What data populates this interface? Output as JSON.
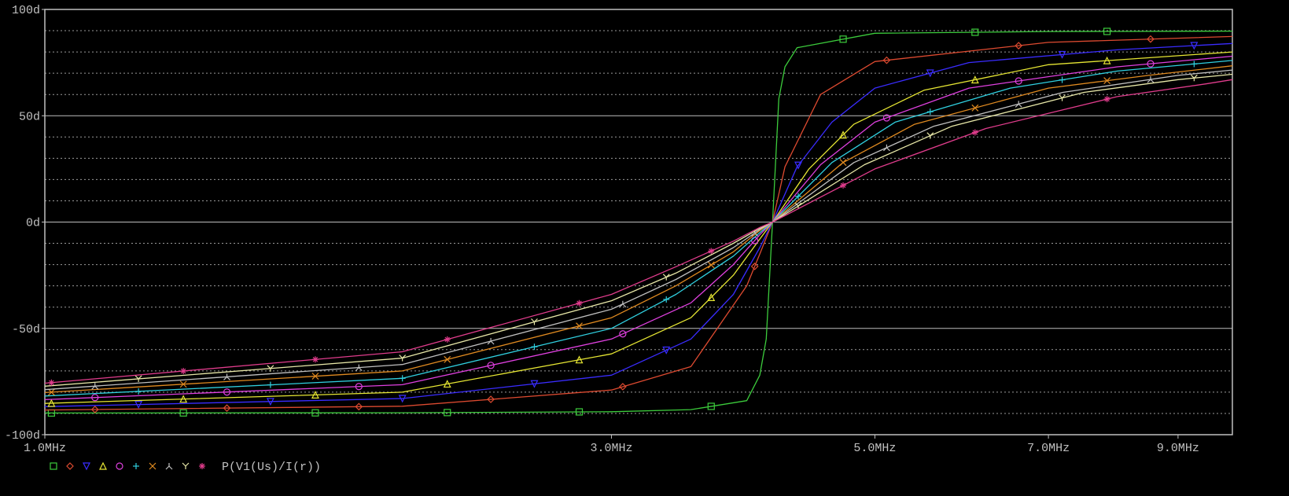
{
  "chart_data": {
    "type": "line",
    "x_scale": "log",
    "x_range_hz": [
      1000000,
      10000000
    ],
    "ylim": [
      -100,
      100
    ],
    "x_ticks": [
      {
        "value": 1000000,
        "label": "1.0MHz"
      },
      {
        "value": 3000000,
        "label": "3.0MHz"
      },
      {
        "value": 5000000,
        "label": "5.0MHz"
      },
      {
        "value": 7000000,
        "label": "7.0MHz"
      },
      {
        "value": 9000000,
        "label": "9.0MHz"
      }
    ],
    "y_ticks": [
      {
        "value": 100,
        "label": "100d"
      },
      {
        "value": 50,
        "label": "50d"
      },
      {
        "value": 0,
        "label": "0d"
      },
      {
        "value": -50,
        "label": "-50d"
      },
      {
        "value": -100,
        "label": "-100d"
      }
    ],
    "grid": "solid at labeled y ticks, dotted at 10d steps",
    "background": "#000000",
    "axis_color": "#c0c0c0",
    "center_frequency_hz": 4100000,
    "legend": {
      "position": "bottom-left",
      "label": "P(V1(Us)/I(r))"
    },
    "series": [
      {
        "color": "#3ccc3c",
        "marker": "square",
        "x": [
          1000000,
          2000000,
          3000000,
          3500000,
          3900000,
          4000000,
          4050000,
          4100000,
          4150000,
          4200000,
          4300000,
          5000000,
          7000000,
          10000000
        ],
        "y": [
          -89.8,
          -89.7,
          -89.2,
          -88.2,
          -84,
          -72,
          -55,
          0,
          58,
          73,
          82,
          88.8,
          89.6,
          89.8
        ]
      },
      {
        "color": "#dd4a30",
        "marker": "diamond",
        "x": [
          1000000,
          2000000,
          3000000,
          3500000,
          3900000,
          4000000,
          4100000,
          4200000,
          4500000,
          5000000,
          7000000,
          10000000
        ],
        "y": [
          -88.4,
          -86.6,
          -79,
          -68,
          -30,
          -15,
          0,
          26,
          60,
          75.5,
          84.5,
          87.3
        ]
      },
      {
        "color": "#3a2cff",
        "marker": "triangle-down",
        "x": [
          1000000,
          2000000,
          3000000,
          3500000,
          3800000,
          4000000,
          4100000,
          4300000,
          4600000,
          5000000,
          6000000,
          8000000,
          10000000
        ],
        "y": [
          -86.8,
          -83,
          -72,
          -55,
          -34,
          -12,
          0,
          26,
          47,
          63,
          75,
          81,
          84
        ]
      },
      {
        "color": "#e6e633",
        "marker": "triangle-up",
        "x": [
          1000000,
          2000000,
          3000000,
          3500000,
          3800000,
          4000000,
          4100000,
          4400000,
          4800000,
          5500000,
          7000000,
          10000000
        ],
        "y": [
          -85.3,
          -80,
          -62,
          -45,
          -25,
          -8,
          0,
          25,
          46,
          62,
          74,
          80
        ]
      },
      {
        "color": "#e040e0",
        "marker": "circle",
        "x": [
          1000000,
          2000000,
          3000000,
          3500000,
          3800000,
          4000000,
          4100000,
          4500000,
          5000000,
          6000000,
          8000000,
          10000000
        ],
        "y": [
          -83.5,
          -76.5,
          -55,
          -38,
          -20,
          -6,
          0,
          27,
          47,
          63,
          73,
          78
        ]
      },
      {
        "color": "#30d0e0",
        "marker": "plus",
        "x": [
          1000000,
          2000000,
          3000000,
          3400000,
          3800000,
          4000000,
          4100000,
          4600000,
          5200000,
          6500000,
          8000000,
          10000000
        ],
        "y": [
          -81.8,
          -73.5,
          -50,
          -34,
          -16,
          -5,
          0,
          28,
          47,
          63,
          71,
          76
        ]
      },
      {
        "color": "#e08a20",
        "marker": "x",
        "x": [
          1000000,
          2000000,
          3000000,
          3400000,
          3800000,
          4000000,
          4100000,
          4700000,
          5400000,
          7000000,
          8500000,
          10000000
        ],
        "y": [
          -80.2,
          -70,
          -45,
          -30,
          -14,
          -4,
          0,
          28,
          46,
          63,
          69,
          73.5
        ]
      },
      {
        "color": "#c0c0c0",
        "marker": "lambda",
        "x": [
          1000000,
          2000000,
          3000000,
          3400000,
          3800000,
          4000000,
          4100000,
          4800000,
          5600000,
          7200000,
          9000000,
          10000000
        ],
        "y": [
          -78.8,
          -67,
          -41,
          -27,
          -12,
          -3.5,
          0,
          28,
          45,
          61,
          69,
          71.5
        ]
      },
      {
        "color": "#e8e8a8",
        "marker": "y",
        "x": [
          1000000,
          2000000,
          3000000,
          3400000,
          3800000,
          4000000,
          4100000,
          4900000,
          5800000,
          7500000,
          9000000,
          10000000
        ],
        "y": [
          -77.2,
          -64,
          -37,
          -24,
          -10,
          -3,
          0,
          27,
          45,
          61,
          67,
          69.5
        ]
      },
      {
        "color": "#e03c8c",
        "marker": "asterisk",
        "x": [
          1000000,
          2000000,
          3000000,
          3400000,
          3800000,
          4000000,
          4100000,
          5000000,
          6200000,
          8000000,
          9500000,
          10000000
        ],
        "y": [
          -75.8,
          -61,
          -34,
          -21,
          -9,
          -2.5,
          0,
          25,
          44,
          59,
          65,
          67
        ]
      }
    ]
  }
}
